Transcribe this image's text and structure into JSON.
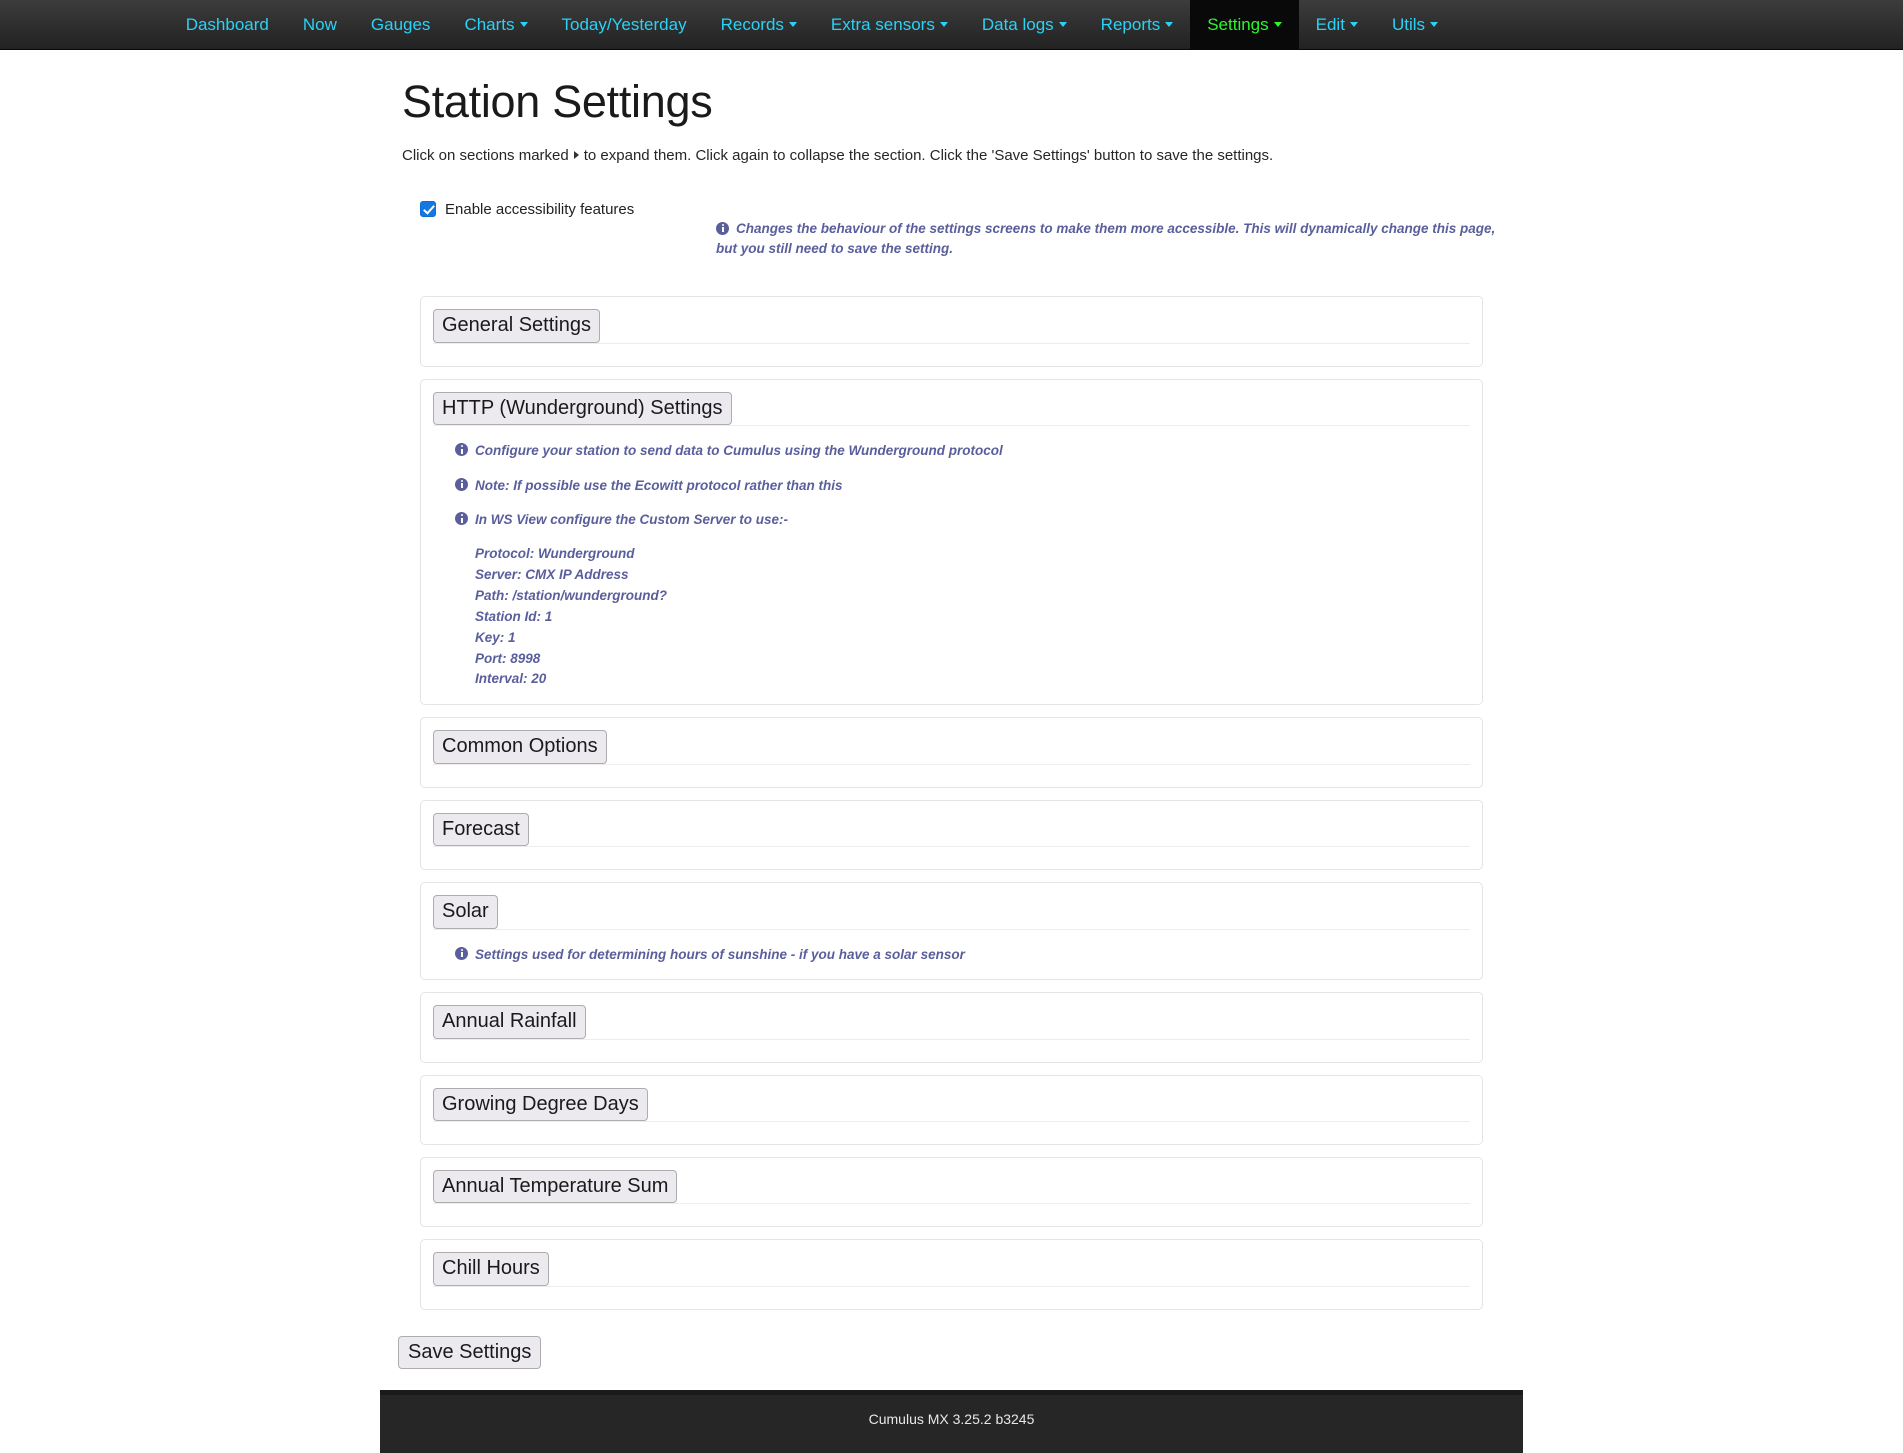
{
  "navbar": {
    "items": [
      {
        "label": "Dashboard",
        "caret": false,
        "active": false
      },
      {
        "label": "Now",
        "caret": false,
        "active": false
      },
      {
        "label": "Gauges",
        "caret": false,
        "active": false
      },
      {
        "label": "Charts",
        "caret": true,
        "active": false
      },
      {
        "label": "Today/Yesterday",
        "caret": false,
        "active": false
      },
      {
        "label": "Records",
        "caret": true,
        "active": false
      },
      {
        "label": "Extra sensors",
        "caret": true,
        "active": false
      },
      {
        "label": "Data logs",
        "caret": true,
        "active": false
      },
      {
        "label": "Reports",
        "caret": true,
        "active": false
      },
      {
        "label": "Settings",
        "caret": true,
        "active": true
      },
      {
        "label": "Edit",
        "caret": true,
        "active": false
      },
      {
        "label": "Utils",
        "caret": true,
        "active": false
      }
    ],
    "link_color": "#29d2f7",
    "active_color": "#2bf72b"
  },
  "page": {
    "title": "Station Settings",
    "description_before": "Click on sections marked",
    "description_after": "to expand them. Click again to collapse the section. Click the 'Save Settings' button to save the settings."
  },
  "accessibility": {
    "checkbox_label": "Enable accessibility features",
    "checked": true,
    "note": "Changes the behaviour of the settings screens to make them more accessible. This will dynamically change this page, but you still need to save the setting."
  },
  "sections": [
    {
      "title": "General Settings",
      "notes": [],
      "config": []
    },
    {
      "title": "HTTP (Wunderground) Settings",
      "notes": [
        "Configure your station to send data to Cumulus using the Wunderground protocol",
        "Note: If possible use the Ecowitt protocol rather than this",
        "In WS View configure the Custom Server to use:-"
      ],
      "config": [
        "Protocol: Wunderground",
        "Server: CMX IP Address",
        "Path: /station/wunderground?",
        "Station Id: 1",
        "Key: 1",
        "Port: 8998",
        "Interval: 20"
      ]
    },
    {
      "title": "Common Options",
      "notes": [],
      "config": []
    },
    {
      "title": "Forecast",
      "notes": [],
      "config": []
    },
    {
      "title": "Solar",
      "notes": [
        "Settings used for determining hours of sunshine - if you have a solar sensor"
      ],
      "config": []
    },
    {
      "title": "Annual Rainfall",
      "notes": [],
      "config": []
    },
    {
      "title": "Growing Degree Days",
      "notes": [],
      "config": []
    },
    {
      "title": "Annual Temperature Sum",
      "notes": [],
      "config": []
    },
    {
      "title": "Chill Hours",
      "notes": [],
      "config": []
    }
  ],
  "save": {
    "label": "Save Settings"
  },
  "footer": {
    "text": "Cumulus MX 3.25.2 b3245"
  },
  "colors": {
    "info_text": "#5a5f9c",
    "navbar_bg": "#262626",
    "panel_border": "#e4e4e4",
    "button_bg": "#eceaef"
  }
}
